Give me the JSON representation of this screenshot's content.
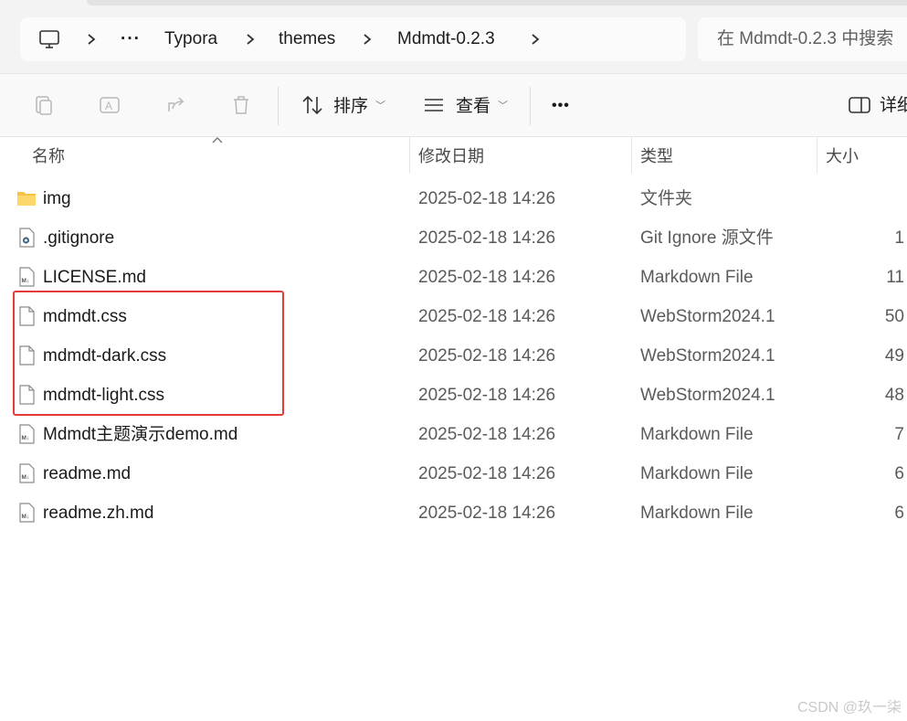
{
  "breadcrumb": {
    "more": "···",
    "items": [
      "Typora",
      "themes",
      "Mdmdt-0.2.3"
    ]
  },
  "search": {
    "placeholder": "在 Mdmdt-0.2.3 中搜索"
  },
  "toolbar": {
    "sort_label": "排序",
    "view_label": "查看",
    "more_label": "•••",
    "details_label": "详细信息"
  },
  "columns": {
    "name": "名称",
    "date": "修改日期",
    "type": "类型",
    "size": "大小"
  },
  "files": [
    {
      "name": "img",
      "date": "2025-02-18 14:26",
      "type": "文件夹",
      "size": "",
      "icon": "folder-icon"
    },
    {
      "name": ".gitignore",
      "date": "2025-02-18 14:26",
      "type": "Git Ignore 源文件",
      "size": "1",
      "icon": "gear-file-icon"
    },
    {
      "name": "LICENSE.md",
      "date": "2025-02-18 14:26",
      "type": "Markdown File",
      "size": "11",
      "icon": "markdown-file-icon"
    },
    {
      "name": "mdmdt.css",
      "date": "2025-02-18 14:26",
      "type": "WebStorm2024.1",
      "size": "50",
      "icon": "file-icon"
    },
    {
      "name": "mdmdt-dark.css",
      "date": "2025-02-18 14:26",
      "type": "WebStorm2024.1",
      "size": "49",
      "icon": "file-icon"
    },
    {
      "name": "mdmdt-light.css",
      "date": "2025-02-18 14:26",
      "type": "WebStorm2024.1",
      "size": "48",
      "icon": "file-icon"
    },
    {
      "name": "Mdmdt主题演示demo.md",
      "date": "2025-02-18 14:26",
      "type": "Markdown File",
      "size": "7",
      "icon": "markdown-file-icon"
    },
    {
      "name": "readme.md",
      "date": "2025-02-18 14:26",
      "type": "Markdown File",
      "size": "6",
      "icon": "markdown-file-icon"
    },
    {
      "name": "readme.zh.md",
      "date": "2025-02-18 14:26",
      "type": "Markdown File",
      "size": "6",
      "icon": "markdown-file-icon"
    }
  ],
  "watermark": "CSDN @玖一柒",
  "colors": {
    "highlight": "#e53a3a",
    "folder": "#f6c343"
  }
}
